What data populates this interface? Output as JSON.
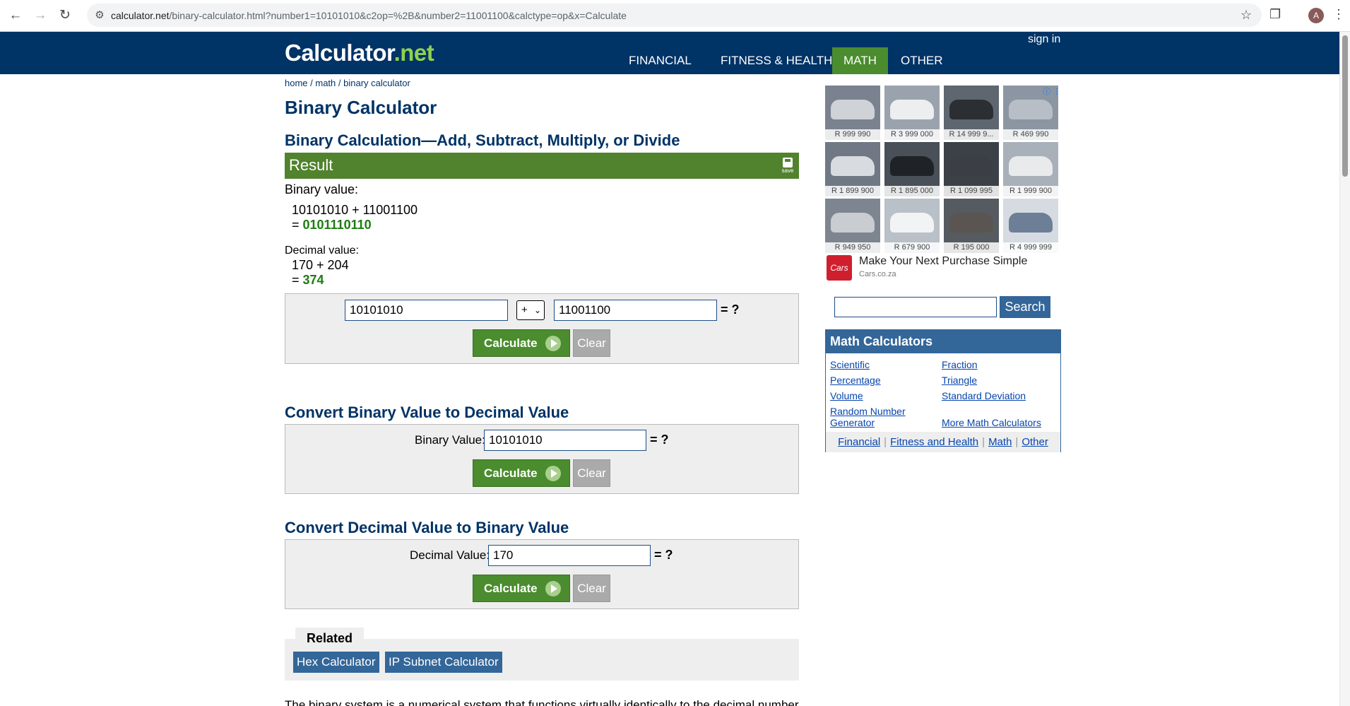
{
  "browser": {
    "url_host": "calculator.net",
    "url_path": "/binary-calculator.html?number1=10101010&c2op=%2B&number2=11001100&calctype=op&x=Calculate",
    "avatar_letter": "A"
  },
  "header": {
    "logo_main": "Calculator",
    "logo_dot": ".",
    "logo_suffix": "net",
    "sign_in": "sign in",
    "nav": [
      "FINANCIAL",
      "FITNESS & HEALTH",
      "MATH",
      "OTHER"
    ],
    "active_nav": "MATH",
    "colors": {
      "header_bg": "#003366",
      "active_tab": "#4a8c2e",
      "logo_accent": "#8fd14f"
    }
  },
  "breadcrumb": [
    "home",
    "math",
    "binary calculator"
  ],
  "page_title": "Binary Calculator",
  "calc": {
    "section_title": "Binary Calculation—Add, Subtract, Multiply, or Divide",
    "result_label": "Result",
    "save_label": "save",
    "binary_label": "Binary value:",
    "binary_expr": "10101010 + 11001100",
    "eq_prefix": "= ",
    "binary_result": "0101110110",
    "decimal_label": "Decimal value:",
    "decimal_expr": "170 + 204",
    "decimal_result": "374",
    "number1": "10101010",
    "operator": "+",
    "number2": "11001100",
    "eq_q": "= ?",
    "calculate": "Calculate",
    "clear": "Clear"
  },
  "bin2dec": {
    "title": "Convert Binary Value to Decimal Value",
    "label": "Binary Value:",
    "value": "10101010"
  },
  "dec2bin": {
    "title": "Convert Decimal Value to Binary Value",
    "label": "Decimal Value:",
    "value": "170"
  },
  "related": {
    "title": "Related",
    "links": [
      "Hex Calculator",
      "IP Subnet Calculator"
    ]
  },
  "intro_text": "The binary system is a numerical system that functions virtually identically to the decimal number",
  "ad": {
    "prices": [
      "R 999 990",
      "R 3 999 000",
      "R 14 999 9...",
      "R 469 990",
      "R 1 899 900",
      "R 1 895 000",
      "R 1 099 995",
      "R 1 999 900",
      "R 949 950",
      "R 679 900",
      "R 195 000",
      "R 4 999 999"
    ],
    "logo_text": "Cars",
    "headline": "Make Your Next Purchase Simple",
    "domain": "Cars.co.za"
  },
  "sidebar": {
    "search_button": "Search",
    "math_box_title": "Math Calculators",
    "links_left": [
      "Scientific",
      "Percentage",
      "Volume",
      "Random Number Generator"
    ],
    "links_right": [
      "Fraction",
      "Triangle",
      "Standard Deviation",
      "More Math Calculators"
    ],
    "footer_links": [
      "Financial",
      "Fitness and Health",
      "Math",
      "Other"
    ]
  }
}
